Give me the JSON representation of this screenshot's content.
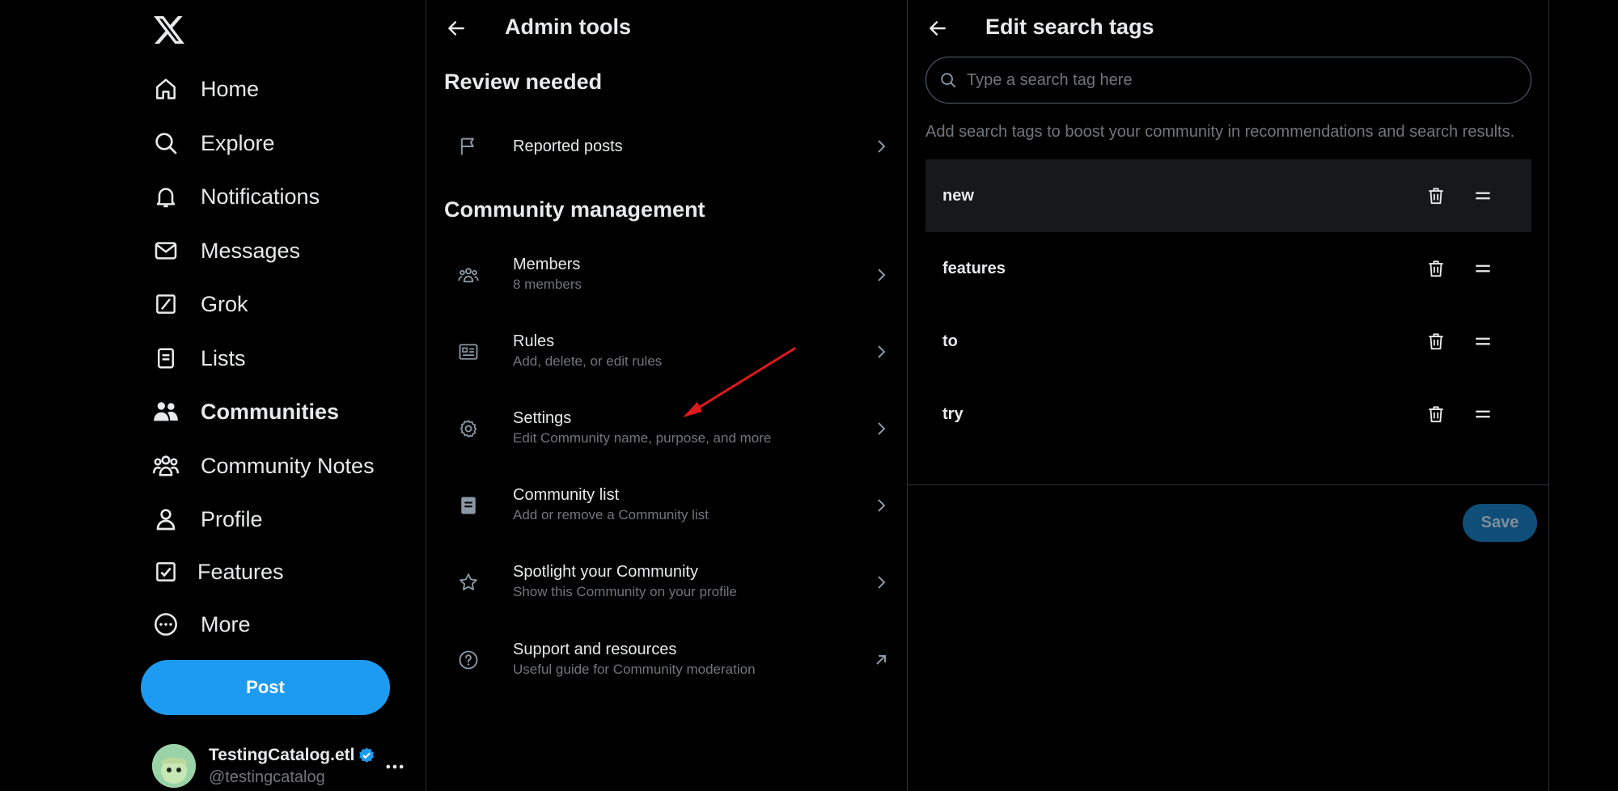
{
  "nav": {
    "items": [
      {
        "label": "Home",
        "icon": "home-icon"
      },
      {
        "label": "Explore",
        "icon": "search-icon"
      },
      {
        "label": "Notifications",
        "icon": "bell-icon"
      },
      {
        "label": "Messages",
        "icon": "envelope-icon"
      },
      {
        "label": "Grok",
        "icon": "grok-icon"
      },
      {
        "label": "Lists",
        "icon": "list-icon"
      },
      {
        "label": "Communities",
        "icon": "communities-icon",
        "active": true
      },
      {
        "label": "Community Notes",
        "icon": "community-notes-icon"
      },
      {
        "label": "Profile",
        "icon": "person-icon"
      },
      {
        "label": "Features",
        "icon": "checkbox-icon"
      },
      {
        "label": "More",
        "icon": "more-circle-icon"
      }
    ],
    "post_label": "Post",
    "account": {
      "name": "TestingCatalog.etl",
      "handle": "@testingcatalog",
      "verified_color": "#1d9bf0"
    }
  },
  "admin": {
    "title": "Admin tools",
    "review_heading": "Review needed",
    "reported": {
      "title": "Reported posts"
    },
    "management_heading": "Community management",
    "items": [
      {
        "title": "Members",
        "subtitle": "8 members",
        "icon": "people-icon"
      },
      {
        "title": "Rules",
        "subtitle": "Add, delete, or edit rules",
        "icon": "rules-icon"
      },
      {
        "title": "Settings",
        "subtitle": "Edit Community name, purpose, and more",
        "icon": "gear-icon"
      },
      {
        "title": "Community list",
        "subtitle": "Add or remove a Community list",
        "icon": "document-icon"
      },
      {
        "title": "Spotlight your Community",
        "subtitle": "Show this Community on your profile",
        "icon": "star-icon"
      },
      {
        "title": "Support and resources",
        "subtitle": "Useful guide for Community moderation",
        "icon": "help-icon"
      }
    ]
  },
  "tags_panel": {
    "title": "Edit search tags",
    "search_placeholder": "Type a search tag here",
    "helper": "Add search tags to boost your community in recommendations and search results.",
    "tags": [
      "new",
      "features",
      "to",
      "try"
    ],
    "save_label": "Save"
  },
  "colors": {
    "background": "#000000",
    "accent": "#1d9bf0",
    "text_primary": "#e7e9ea",
    "text_secondary": "#71767b",
    "annotation_arrow": "#e0191e",
    "save_disabled": "#0f4e78"
  }
}
